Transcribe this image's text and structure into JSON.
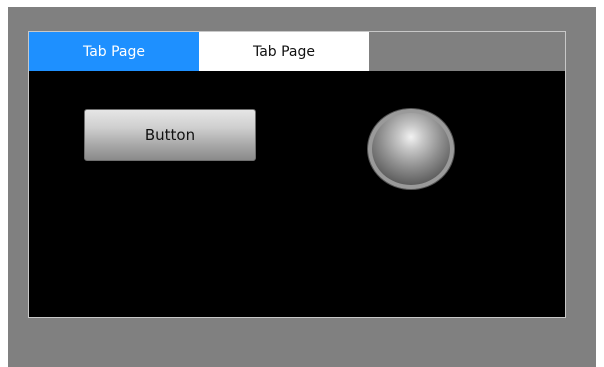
{
  "tabs": [
    {
      "label": "Tab Page",
      "active": true
    },
    {
      "label": "Tab Page",
      "active": false
    }
  ],
  "page": {
    "button_label": "Button"
  },
  "colors": {
    "background": "#808080",
    "active_tab": "#1e90ff",
    "inactive_tab": "#ffffff",
    "page_background": "#000000"
  },
  "icons": {
    "indicator": "round-indicator-lamp"
  }
}
